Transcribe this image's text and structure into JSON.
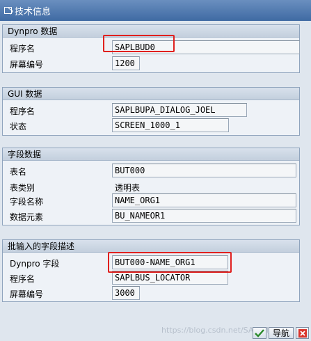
{
  "window": {
    "title": "技术信息"
  },
  "groups": {
    "dynpro": {
      "header": "Dynpro 数据",
      "program_label": "程序名",
      "program_value": "SAPLBUD0",
      "screen_label": "屏幕编号",
      "screen_value": "1200"
    },
    "gui": {
      "header": "GUI 数据",
      "program_label": "程序名",
      "program_value": "SAPLBUPA_DIALOG_JOEL",
      "status_label": "状态",
      "status_value": "SCREEN_1000_1"
    },
    "field_data": {
      "header": "字段数据",
      "table_label": "表名",
      "table_value": "BUT000",
      "table_type_label": "表类别",
      "table_type_value": "透明表",
      "field_name_label": "字段名称",
      "field_name_value": "NAME_ORG1",
      "data_element_label": "数据元素",
      "data_element_value": "BU_NAMEOR1"
    },
    "batch_input": {
      "header": "批输入的字段描述",
      "dynpro_field_label": "Dynpro 字段",
      "dynpro_field_value": "BUT000-NAME_ORG1",
      "program_label": "程序名",
      "program_value": "SAPLBUS_LOCATOR",
      "screen_label": "屏幕编号",
      "screen_value": "3000"
    }
  },
  "footer": {
    "nav_label": "导航",
    "watermark": "https://blog.csdn.net/SAP_MJ"
  },
  "colors": {
    "title_bar": "#3f6aa3",
    "highlight": "#e0201e"
  }
}
